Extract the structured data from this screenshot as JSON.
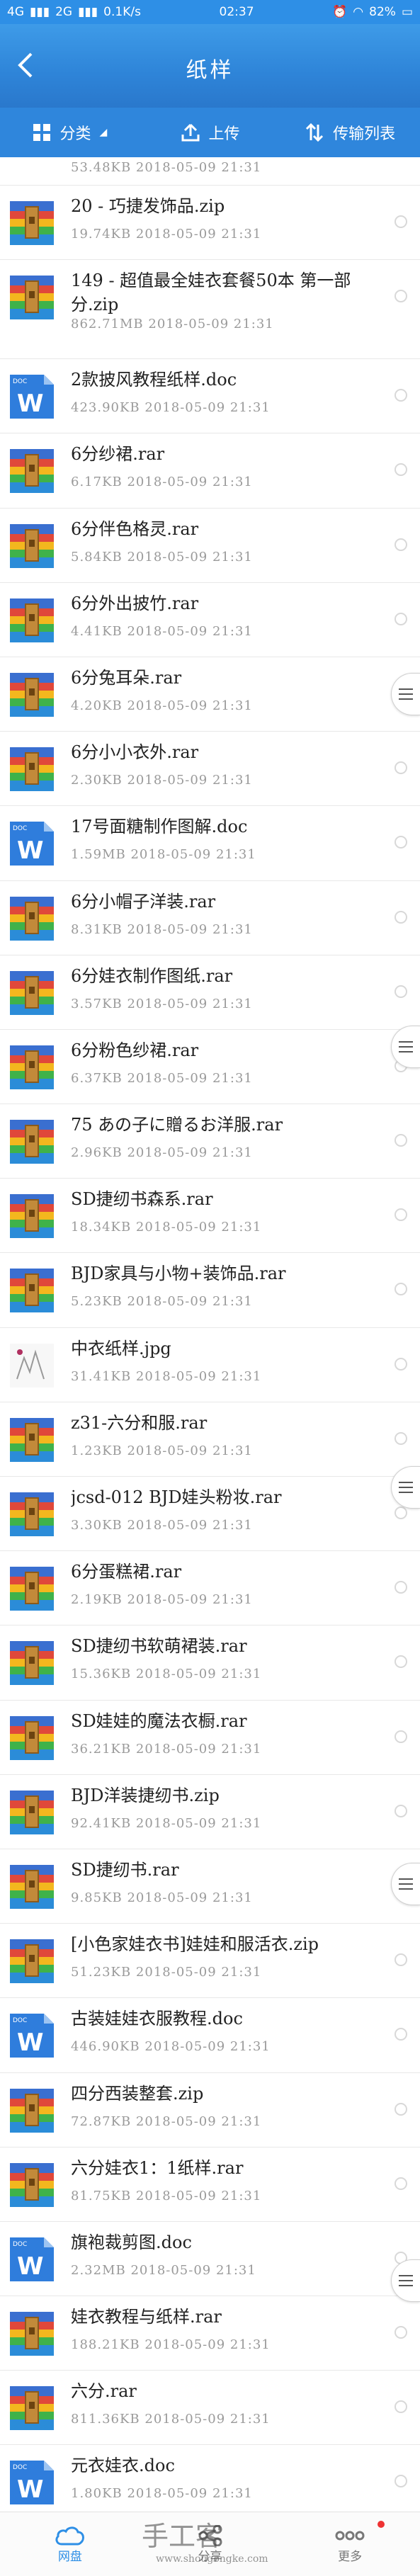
{
  "status_bar": {
    "network": "4G",
    "network2": "2G",
    "speed": "0.1K/s",
    "time": "02:37",
    "battery": "82%"
  },
  "header": {
    "title": "纸样"
  },
  "toolbar": {
    "category_label": "分类",
    "upload_label": "上传",
    "transfer_label": "传输列表"
  },
  "files": [
    {
      "name": "",
      "meta": "53.48KB  2018-05-09  21:31",
      "type": "rar"
    },
    {
      "name": "20 - 巧捷发饰品.zip",
      "meta": "19.74KB  2018-05-09  21:31",
      "type": "rar"
    },
    {
      "name": "149 - 超值最全娃衣套餐50本 第一部分.zip",
      "meta": "862.71MB  2018-05-09  21:31",
      "type": "rar"
    },
    {
      "name": "2款披风教程纸样.doc",
      "meta": "423.90KB  2018-05-09  21:31",
      "type": "doc"
    },
    {
      "name": "6分纱裙.rar",
      "meta": "6.17KB  2018-05-09  21:31",
      "type": "rar"
    },
    {
      "name": "6分伴色格灵.rar",
      "meta": "5.84KB  2018-05-09  21:31",
      "type": "rar"
    },
    {
      "name": "6分外出披竹.rar",
      "meta": "4.41KB  2018-05-09  21:31",
      "type": "rar"
    },
    {
      "name": "6分兔耳朵.rar",
      "meta": "4.20KB  2018-05-09  21:31",
      "type": "rar"
    },
    {
      "name": "6分小小衣外.rar",
      "meta": "2.30KB  2018-05-09  21:31",
      "type": "rar"
    },
    {
      "name": "17号面糖制作图解.doc",
      "meta": "1.59MB  2018-05-09  21:31",
      "type": "doc"
    },
    {
      "name": "6分小帽子洋装.rar",
      "meta": "8.31KB  2018-05-09  21:31",
      "type": "rar"
    },
    {
      "name": "6分娃衣制作图纸.rar",
      "meta": "3.57KB  2018-05-09  21:31",
      "type": "rar"
    },
    {
      "name": "6分粉色纱裙.rar",
      "meta": "6.37KB  2018-05-09  21:31",
      "type": "rar"
    },
    {
      "name": "75 あの子に贈るお洋服.rar",
      "meta": "2.96KB  2018-05-09  21:31",
      "type": "rar"
    },
    {
      "name": "SD捷纫书森系.rar",
      "meta": "18.34KB  2018-05-09  21:31",
      "type": "rar"
    },
    {
      "name": "BJD家具与小物+装饰品.rar",
      "meta": "5.23KB  2018-05-09  21:31",
      "type": "rar"
    },
    {
      "name": "中衣纸样.jpg",
      "meta": "31.41KB  2018-05-09  21:31",
      "type": "jpg"
    },
    {
      "name": "z31-六分和服.rar",
      "meta": "1.23KB  2018-05-09  21:31",
      "type": "rar"
    },
    {
      "name": "jcsd-012 BJD娃头粉妆.rar",
      "meta": "3.30KB  2018-05-09  21:31",
      "type": "rar"
    },
    {
      "name": "6分蛋糕裙.rar",
      "meta": "2.19KB  2018-05-09  21:31",
      "type": "rar"
    },
    {
      "name": "SD捷纫书软萌裙装.rar",
      "meta": "15.36KB  2018-05-09  21:31",
      "type": "rar"
    },
    {
      "name": "SD娃娃的魔法衣橱.rar",
      "meta": "36.21KB  2018-05-09  21:31",
      "type": "rar"
    },
    {
      "name": "BJD洋装捷纫书.zip",
      "meta": "92.41KB  2018-05-09  21:31",
      "type": "rar"
    },
    {
      "name": "SD捷纫书.rar",
      "meta": "9.85KB  2018-05-09  21:31",
      "type": "rar"
    },
    {
      "name": "[小色家娃衣书]娃娃和服活衣.zip",
      "meta": "51.23KB  2018-05-09  21:31",
      "type": "rar"
    },
    {
      "name": "古装娃娃衣服教程.doc",
      "meta": "446.90KB  2018-05-09  21:31",
      "type": "doc"
    },
    {
      "name": "四分西装整套.zip",
      "meta": "72.87KB  2018-05-09  21:31",
      "type": "rar"
    },
    {
      "name": "六分娃衣1：1纸样.rar",
      "meta": "81.75KB  2018-05-09  21:31",
      "type": "rar"
    },
    {
      "name": "旗袍裁剪图.doc",
      "meta": "2.32MB  2018-05-09  21:31",
      "type": "doc"
    },
    {
      "name": "娃衣教程与纸样.rar",
      "meta": "188.21KB  2018-05-09  21:31",
      "type": "rar"
    },
    {
      "name": "六分.rar",
      "meta": "811.36KB  2018-05-09  21:31",
      "type": "rar"
    },
    {
      "name": "元衣娃衣.doc",
      "meta": "1.80KB  2018-05-09  21:31",
      "type": "doc"
    }
  ],
  "bottom_nav": {
    "netdisk_label": "网盘",
    "share_label": "分享",
    "more_label": "更多"
  },
  "watermark": {
    "text": "手工客",
    "url": "www.shougongke.com"
  },
  "colors": {
    "primary": "#2e8fe6",
    "toolbar": "#2f86dc"
  }
}
